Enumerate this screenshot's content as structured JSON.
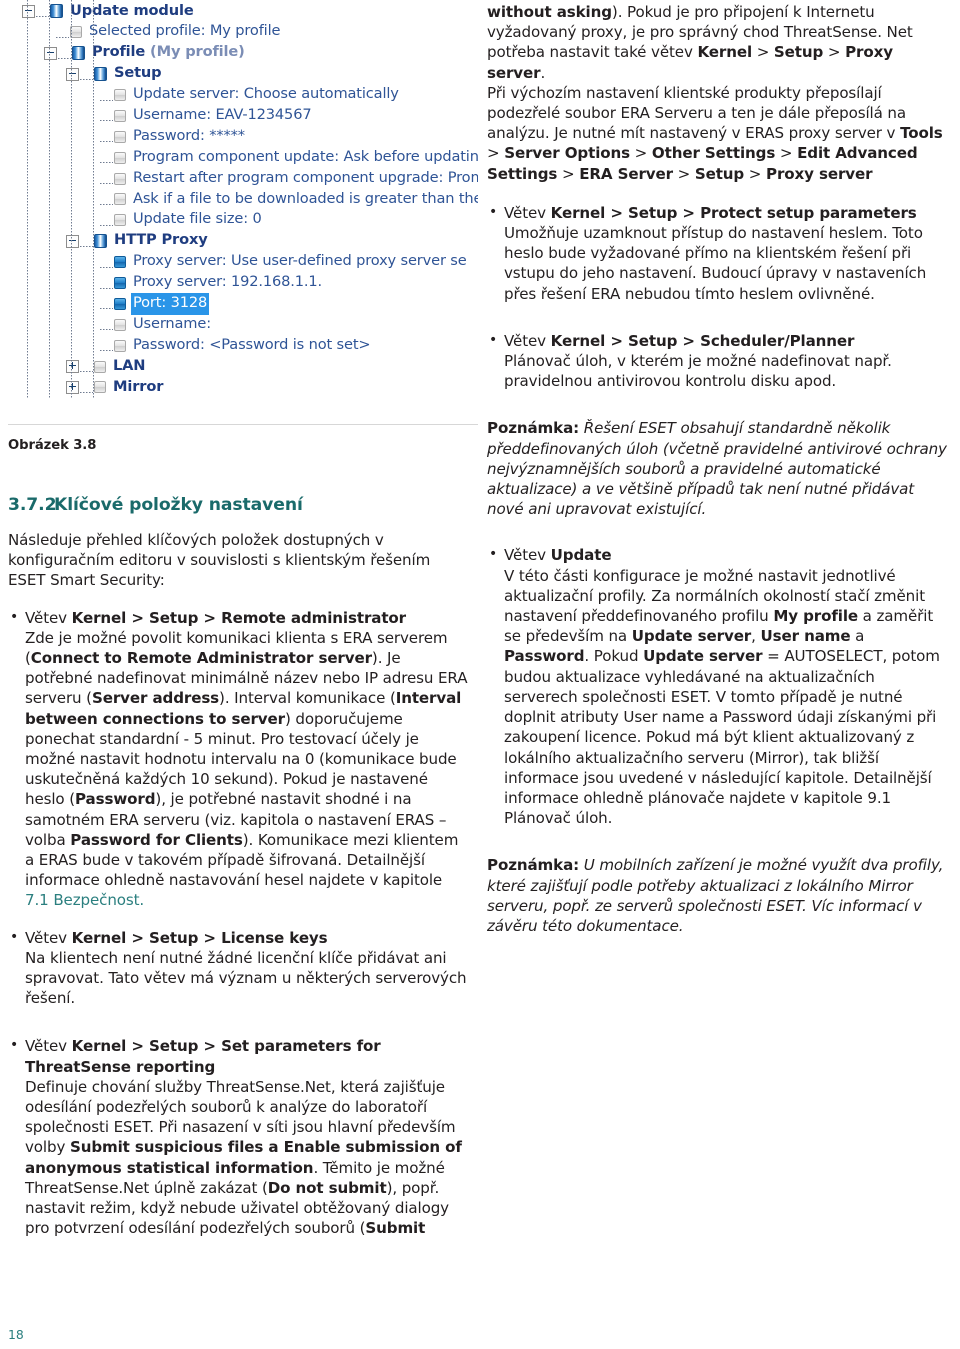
{
  "figure": {
    "caption": "Obrázek 3.8",
    "tree": {
      "title_icon": "module-icon",
      "nodes": [
        {
          "level": 0,
          "expander": "minus",
          "icon": "module-icon",
          "label": "Update module",
          "style": "bold"
        },
        {
          "level": 1,
          "expander": "none",
          "icon": "leaf-gray-icon",
          "label": "Selected profile: My profile",
          "style": "plain"
        },
        {
          "level": 1,
          "expander": "minus",
          "icon": "module-icon",
          "label": "Profile",
          "suffix": " (My profile)",
          "style": "bold"
        },
        {
          "level": 2,
          "expander": "minus",
          "icon": "module-icon",
          "label": "Setup",
          "style": "bold"
        },
        {
          "level": 3,
          "expander": "none",
          "icon": "leaf-gray-icon",
          "label": "Update server: Choose automatically",
          "style": "plain"
        },
        {
          "level": 3,
          "expander": "none",
          "icon": "leaf-gray-icon",
          "label": "Username: EAV-1234567",
          "style": "plain"
        },
        {
          "level": 3,
          "expander": "none",
          "icon": "leaf-gray-icon",
          "label": "Password: *****",
          "style": "plain"
        },
        {
          "level": 3,
          "expander": "none",
          "icon": "leaf-gray-icon",
          "label": "Program component update: Ask before updating p",
          "style": "plain"
        },
        {
          "level": 3,
          "expander": "none",
          "icon": "leaf-gray-icon",
          "label": "Restart after program component upgrade: Prompt",
          "style": "plain"
        },
        {
          "level": 3,
          "expander": "none",
          "icon": "leaf-gray-icon",
          "label": "Ask if a file to be downloaded is greater than the sp",
          "style": "plain"
        },
        {
          "level": 3,
          "expander": "none",
          "icon": "leaf-gray-icon",
          "label": "Update file size: 0",
          "style": "plain"
        },
        {
          "level": 2,
          "expander": "minus",
          "icon": "module-icon",
          "label": "HTTP Proxy",
          "style": "bold"
        },
        {
          "level": 3,
          "expander": "none",
          "icon": "leaf-blue-icon",
          "label": "Proxy server: Use user-defined proxy server se",
          "style": "plain"
        },
        {
          "level": 3,
          "expander": "none",
          "icon": "leaf-blue-icon",
          "label": "Proxy server: 192.168.1.1.",
          "style": "plain"
        },
        {
          "level": 3,
          "expander": "none",
          "icon": "leaf-blue-icon",
          "label": "Port: 3128",
          "style": "selected"
        },
        {
          "level": 3,
          "expander": "none",
          "icon": "leaf-gray-icon",
          "label": "Username:",
          "style": "plain"
        },
        {
          "level": 3,
          "expander": "none",
          "icon": "leaf-gray-icon",
          "label": "Password: <Password is not set>",
          "style": "plain"
        },
        {
          "level": 2,
          "expander": "plus",
          "icon": "leaf-gray-icon",
          "label": "LAN",
          "style": "bold"
        },
        {
          "level": 2,
          "expander": "plus",
          "icon": "leaf-gray-icon",
          "label": "Mirror",
          "style": "bold"
        }
      ]
    }
  },
  "left_column": {
    "section": {
      "number": "3.7.2",
      "title": "Klíčové položky nastavení"
    },
    "intro": "Následuje přehled klíčových položek dostupných v konfiguračním editoru v souvislosti s klientským řešením ESET Smart Security:",
    "bullets": [
      {
        "heading_prefix": "Větev ",
        "heading": "Kernel > Setup > Remote administrator",
        "body_html": "Zde je možné povolit komunikaci klienta s ERA serverem (<b>Connect to Remote Administrator server</b>). Je potřebné nadefinovat minimálně název nebo IP adresu ERA serveru (<b>Server address</b>). Interval komunikace (<b>Interval between connections to server</b>) doporučujeme ponechat standardní - 5 minut. Pro testovací účely je možné nastavit hodnotu intervalu na 0 (komunikace bude uskutečněná každých 10 sekund). Pokud je nastavené heslo (<b>Password</b>), je potřebné nastavit shodné i na samotném ERA serveru (viz. kapitola o nastavení ERAS – volba <b>Password for Clients</b>). Komunikace mezi klientem a ERAS bude v takovém případě šifrovaná. Detailnější informace ohledně nastavování hesel najdete v kapitole <span class=\"link\">7.1 Bezpečnost.</span>"
      },
      {
        "heading_prefix": "Větev ",
        "heading": "Kernel > Setup > License keys",
        "body_html": "Na klientech není nutné žádné licenční klíče přidávat ani spravovat. Tato větev má význam u některých serverových řešení."
      },
      {
        "heading_prefix": "Větev ",
        "heading": "Kernel > Setup > Set parameters for ThreatSense reporting",
        "body_html": "Definuje chování služby ThreatSense.Net, která zajišťuje odesílání podezřelých souborů k analýze do laboratoří společnosti ESET. Při nasazení v síti jsou hlavní především volby <b>Submit suspicious files a Enable submission of anonymous statistical information</b>. Těmito je možné ThreatSense.Net úplně zakázat (<b>Do not submit</b>), popř. nastavit režim, když nebude uživatel obtěžovaný dialogy pro potvrzení odesílání podezřelých souborů (<b>Submit</b>"
      }
    ],
    "page_number": "18"
  },
  "right_column": {
    "continuation_html": "<b>without asking</b>). Pokud je pro připojení k Internetu vyžadovaný proxy, je pro správný chod ThreatSense. Net potřeba nastavit také větev <b>Kernel</b> &gt; <b>Setup</b> &gt; <b>Proxy server</b>.",
    "continuation2_html": "Při výchozím nastavení klientské produkty přeposílají podezřelé soubor ERA Serveru a ten je dále přeposílá na analýzu. Je nutné mít nastavený v ERAS proxy server v <b>Tools</b> &gt; <b>Server Options</b> &gt; <b>Other Settings</b> &gt; <b>Edit Advanced Settings</b> &gt; <b>ERA Server</b> &gt; <b>Setup</b> &gt; <b>Proxy server</b>",
    "bullets": [
      {
        "heading_prefix": "Větev ",
        "heading": "Kernel > Setup > Protect setup parameters",
        "body_html": "Umožňuje uzamknout přístup do nastavení heslem. Toto heslo bude vyžadované přímo na klientském řešení při vstupu do jeho nastavení. Budoucí úpravy v nastaveních přes řešení ERA nebudou tímto heslem ovlivněné."
      },
      {
        "heading_prefix": "Větev ",
        "heading": "Kernel > Setup > Scheduler/Planner",
        "body_html": "Plánovač úloh, v kterém je možné nadefinovat např. pravidelnou antivirovou kontrolu disku apod."
      }
    ],
    "note1_label": "Poznámka:",
    "note1_text": " Řešení ESET obsahují standardně několik předdefinovaných úloh (včetně pravidelné antivirové ochrany nejvýznamnějších souborů a pravidelné automatické aktualizace) a ve většině případů tak není nutné přidávat nové ani upravovat existující.",
    "bullet_update": {
      "heading_prefix": "Větev ",
      "heading": "Update",
      "body_html": "V této části konfigurace je možné nastavit jednotlivé aktualizační profily. Za normálních okolností stačí změnit nastavení předdefinovaného profilu <b>My profile</b> a zaměřit se především na <b>Update server</b>, <b>User name</b> a <b>Password</b>. Pokud <b>Update server</b> = AUTOSELECT, potom budou aktualizace vyhledávané na aktualizačních serverech společnosti ESET. V tomto případě je nutné doplnit atributy User name a Password údaji získanými při zakoupení licence. Pokud má být klient aktualizovaný z lokálního aktualizačního serveru (Mirror), tak bližší informace jsou uvedené v následující kapitole. Detailnější informace ohledně plánovače najdete v kapitole 9.1 Plánovač úloh."
    },
    "note2_label": "Poznámka:",
    "note2_text": " U mobilních zařízení je možné využít dva profily, které zajišťují podle potřeby aktualizaci z lokálního Mirror serveru, popř. ze serverů společnosti ESET. Víc informací v závěru této dokumentace."
  },
  "colors": {
    "heading_teal": "#1a6a6a",
    "link_teal": "#2b7f7f",
    "tree_blue": "#2f5496",
    "tree_bold_blue": "#1f3d80",
    "selection_blue": "#2a95e8",
    "body_black": "#231f20"
  }
}
